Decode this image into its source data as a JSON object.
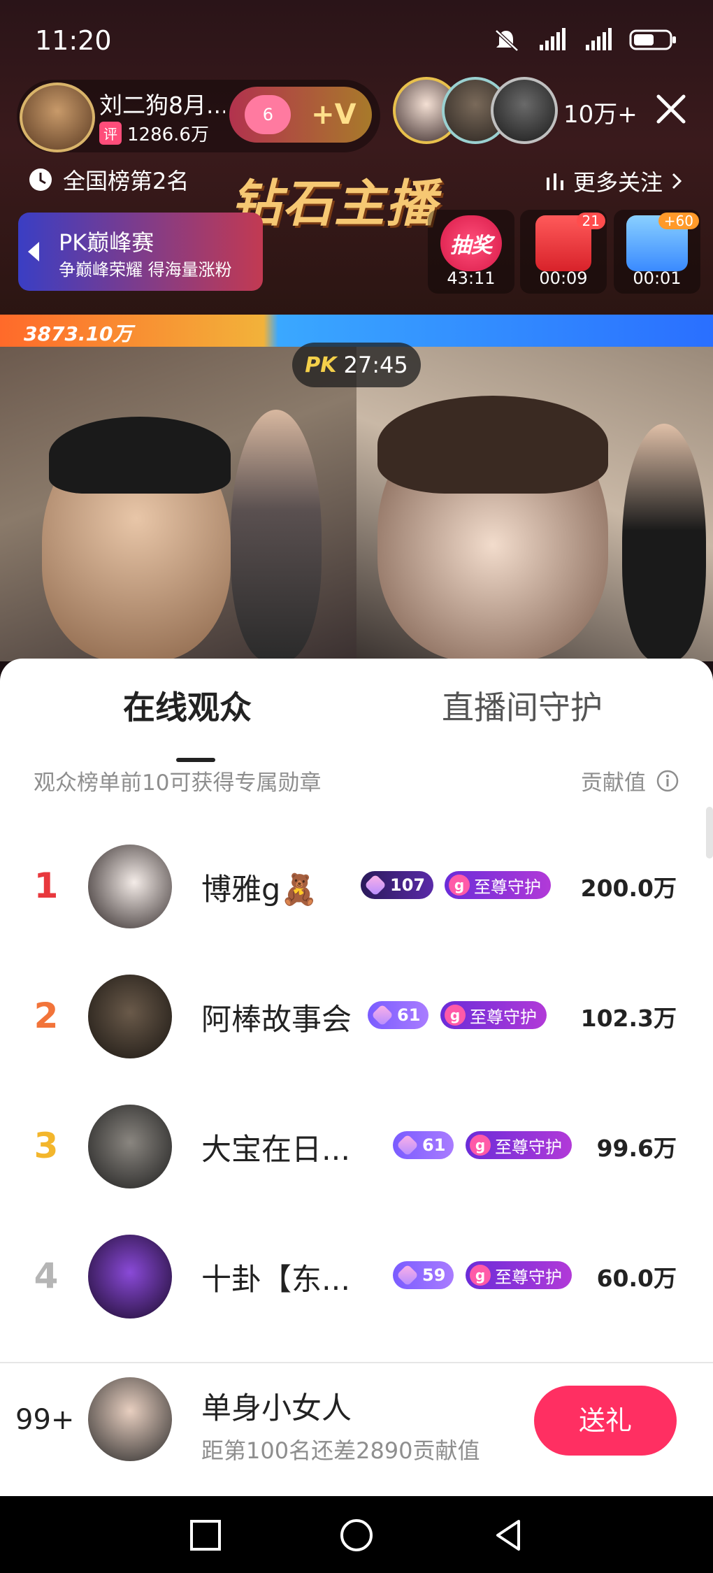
{
  "status_bar": {
    "time": "11:20"
  },
  "anchor": {
    "name": "刘二狗8月...",
    "fan_tag": "评",
    "fans": "1286.6万",
    "fan_club_level": "6",
    "fan_club_vip": "+V",
    "viewer_count": "10万+"
  },
  "room": {
    "rank_label": "全国榜第2名",
    "banner": "钻石主播",
    "more_follow": "更多关注",
    "pk_card": {
      "title": "PK巅峰赛",
      "subtitle": "争巅峰荣耀 得海量涨粉"
    },
    "tasks": [
      {
        "name": "抽奖",
        "time": "43:11",
        "badge": ""
      },
      {
        "name": "red-packet",
        "time": "00:09",
        "badge": "21"
      },
      {
        "name": "popularity",
        "time": "00:01",
        "badge": "+60"
      }
    ]
  },
  "pk": {
    "left_score": "3873.10万",
    "timer_label": "PK",
    "timer": "27:45",
    "left_share": 0.38
  },
  "sheet": {
    "tabs": {
      "online": "在线观众",
      "guard": "直播间守护"
    },
    "hint": "观众榜单前10可获得专属勋章",
    "contrib_label": "贡献值",
    "rows": [
      {
        "rank": "1",
        "name": "博雅g🧸",
        "level": "107",
        "guard": "至尊守护",
        "value": "200.0万"
      },
      {
        "rank": "2",
        "name": "阿棒故事会",
        "level": "61",
        "guard": "至尊守护",
        "value": "102.3万"
      },
      {
        "rank": "3",
        "name": "大宝在日...",
        "level": "61",
        "guard": "至尊守护",
        "value": "99.6万"
      },
      {
        "rank": "4",
        "name": "十卦【东...",
        "level": "59",
        "guard": "至尊守护",
        "value": "60.0万"
      }
    ],
    "colors": {
      "rank1": "#e8383d",
      "rank2": "#f2743a",
      "rank3": "#f3b62c",
      "rank4": "#b5b5b5",
      "gift": "#ff2f62"
    }
  },
  "me": {
    "rank": "99+",
    "name": "单身小女人",
    "gap_text": "距第100名还差2890贡献值",
    "gift_label": "送礼"
  }
}
